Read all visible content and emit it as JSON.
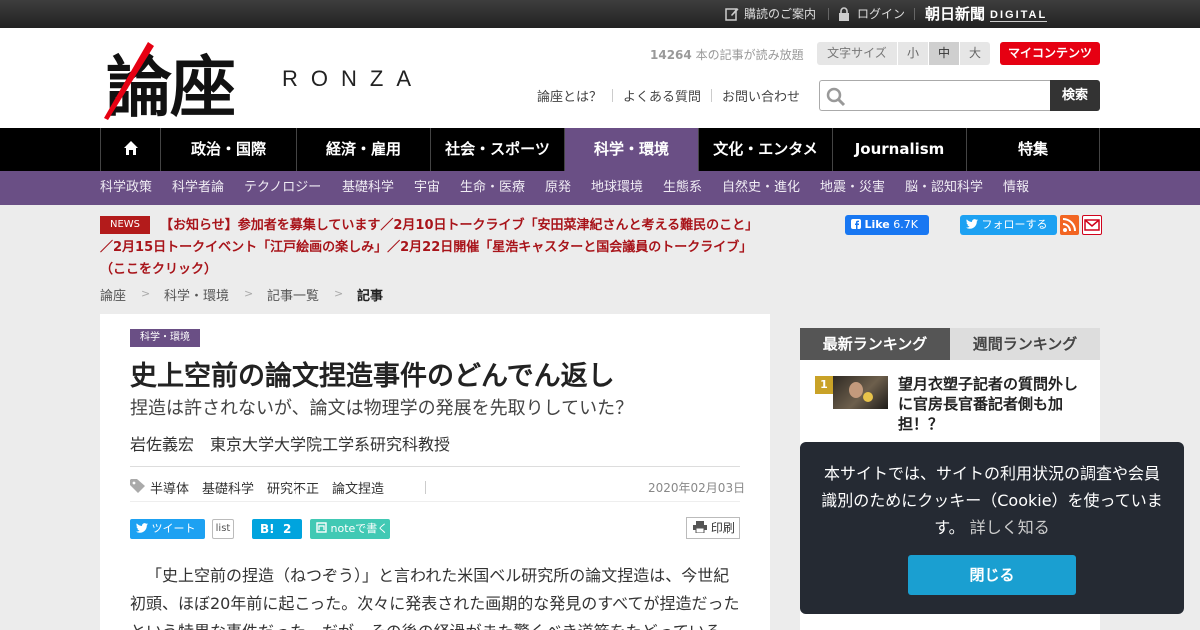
{
  "topbar": {
    "subscribe": "購読のご案内",
    "login": "ログイン",
    "brand": "朝日新聞",
    "brand_digital": "DIGITAL"
  },
  "header": {
    "logo_kanji": "論座",
    "logo_latin": "RONZA",
    "article_count": "14264",
    "article_count_suffix": "本の記事が読み放題",
    "font_size_label": "文字サイズ",
    "font_sizes": [
      "小",
      "中",
      "大"
    ],
    "font_size_selected": "中",
    "my_content": "マイコンテンツ",
    "links": [
      "論座とは？",
      "よくある質問",
      "お問い合わせ"
    ],
    "search_placeholder": "",
    "search_button": "検索"
  },
  "global_nav": [
    "政治・国際",
    "経済・雇用",
    "社会・スポーツ",
    "科学・環境",
    "文化・エンタメ",
    "Journalism",
    "特集"
  ],
  "global_nav_active": "科学・環境",
  "sub_nav": [
    "科学政策",
    "科学者論",
    "テクノロジー",
    "基礎科学",
    "宇宙",
    "生命・医療",
    "原発",
    "地球環境",
    "生態系",
    "自然史・進化",
    "地震・災害",
    "脳・認知科学",
    "情報"
  ],
  "news": {
    "badge": "NEWS",
    "text": "【お知らせ】参加者を募集しています／2月10日トークライブ「安田菜津紀さんと考える難民のこと」／2月15日トークイベント「江戸絵画の楽しみ」／2月22日開催「星浩キャスターと国会議員のトークライブ」（ここをクリック）"
  },
  "social": {
    "fb_like": "Like",
    "fb_count": "6.7K",
    "twitter_follow": "フォローする"
  },
  "breadcrumb": [
    "論座",
    "科学・環境",
    "記事一覧",
    "記事"
  ],
  "article": {
    "category": "科学・環境",
    "title": "史上空前の論文捏造事件のどんでん返し",
    "subtitle": "捏造は許されないが、論文は物理学の発展を先取りしていた？",
    "author": "岩佐義宏　東京大学大学院工学系研究科教授",
    "tags": [
      "半導体",
      "基礎科学",
      "研究不正",
      "論文捏造"
    ],
    "date": "2020年02月03日",
    "share_tweet": "ツイート",
    "share_list": "list",
    "share_hatena_count": "2",
    "share_note": "noteで書く",
    "print": "印刷",
    "body": "「史上空前の捏造（ねつぞう）」と言われた米国ベル研究所の論文捏造は、今世紀初頭、ほぼ20年前に起こった。次々に発表された画期的な発見のすべてが捏造だったという特異な事件だった。だが、その後の経過がまた驚くべき道筋をたどっている。"
  },
  "sidebar": {
    "tabs": [
      "最新ランキング",
      "週間ランキング"
    ],
    "ranking": [
      {
        "rank": "1",
        "title": "望月衣塑子記者の質問外しに官房長官番記者側も加担！？"
      }
    ]
  },
  "cookie": {
    "text": "本サイトでは、サイトの利用状況の調査や会員識別のためにクッキー（Cookie）を使っています。",
    "more": "詳しく知る",
    "close": "閉じる"
  },
  "colors": {
    "accent_purple": "#6a4f85",
    "brand_red": "#e60012",
    "news_red": "#a8141a",
    "twitter": "#1da1f2",
    "facebook": "#1877f2",
    "cookie_button": "#1a9fd1"
  }
}
